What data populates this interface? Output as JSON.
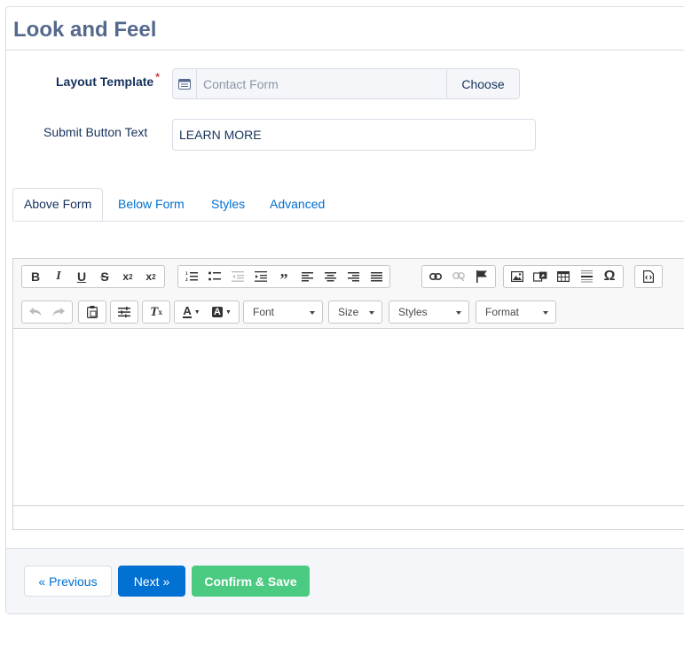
{
  "panel": {
    "title": "Look and Feel"
  },
  "form": {
    "layout_template": {
      "label": "Layout Template",
      "required_mark": "*",
      "value": "Contact Form",
      "button": "Choose"
    },
    "submit_text": {
      "label": "Submit Button Text",
      "value": "LEARN MORE"
    }
  },
  "tabs": [
    {
      "label": "Above Form",
      "active": true
    },
    {
      "label": "Below Form",
      "active": false
    },
    {
      "label": "Styles",
      "active": false
    },
    {
      "label": "Advanced",
      "active": false
    }
  ],
  "editor": {
    "row1_icons": [
      "bold-icon",
      "italic-icon",
      "underline-icon",
      "strikethrough-icon",
      "subscript-icon",
      "superscript-icon",
      "numbered-list-icon",
      "bulleted-list-icon",
      "outdent-icon",
      "indent-icon",
      "blockquote-icon",
      "align-left-icon",
      "align-center-icon",
      "align-right-icon",
      "justify-icon",
      "link-icon",
      "unlink-icon",
      "anchor-flag-icon",
      "image-icon",
      "flash-icon",
      "table-icon",
      "horizontal-line-icon",
      "special-char-icon",
      "source-icon"
    ],
    "row2_icons": [
      "undo-icon",
      "redo-icon",
      "paste-icon",
      "sort-icon",
      "remove-format-icon",
      "text-color-icon",
      "bg-color-icon"
    ],
    "dropdowns": [
      {
        "label": "Font"
      },
      {
        "label": "Size"
      },
      {
        "label": "Styles"
      },
      {
        "label": "Format"
      }
    ]
  },
  "footer": {
    "previous": "« Previous",
    "next": "Next »",
    "confirm": "Confirm & Save"
  },
  "colors": {
    "accent": "#0070d2",
    "success": "#4bca81",
    "title": "#54698d"
  }
}
